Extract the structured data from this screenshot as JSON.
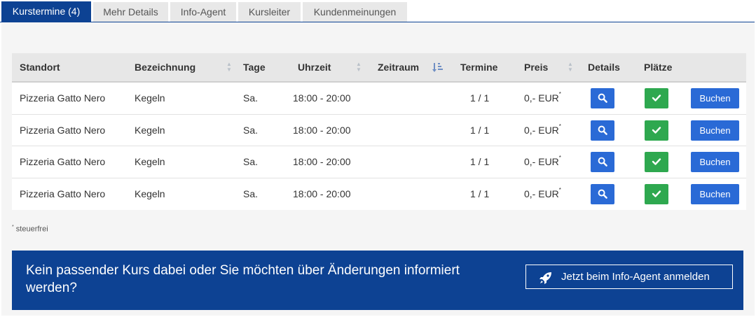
{
  "tabs": [
    {
      "label": "Kurstermine (4)",
      "active": true
    },
    {
      "label": "Mehr Details",
      "active": false
    },
    {
      "label": "Info-Agent",
      "active": false
    },
    {
      "label": "Kursleiter",
      "active": false
    },
    {
      "label": "Kundenmeinungen",
      "active": false
    }
  ],
  "table": {
    "headers": {
      "standort": "Standort",
      "bezeichnung": "Bezeichnung",
      "tage": "Tage",
      "uhrzeit": "Uhrzeit",
      "zeitraum": "Zeitraum",
      "termine": "Termine",
      "preis": "Preis",
      "details": "Details",
      "plaetze": "Plätze"
    },
    "rows": [
      {
        "standort": "Pizzeria Gatto Nero",
        "bezeichnung": "Kegeln",
        "tage": "Sa.",
        "uhrzeit": "18:00 - 20:00",
        "zeitraum": "",
        "termine": "1 / 1",
        "preis": "0,- EUR",
        "preis_mark": "*",
        "book_label": "Buchen"
      },
      {
        "standort": "Pizzeria Gatto Nero",
        "bezeichnung": "Kegeln",
        "tage": "Sa.",
        "uhrzeit": "18:00 - 20:00",
        "zeitraum": "",
        "termine": "1 / 1",
        "preis": "0,- EUR",
        "preis_mark": "*",
        "book_label": "Buchen"
      },
      {
        "standort": "Pizzeria Gatto Nero",
        "bezeichnung": "Kegeln",
        "tage": "Sa.",
        "uhrzeit": "18:00 - 20:00",
        "zeitraum": "",
        "termine": "1 / 1",
        "preis": "0,- EUR",
        "preis_mark": "*",
        "book_label": "Buchen"
      },
      {
        "standort": "Pizzeria Gatto Nero",
        "bezeichnung": "Kegeln",
        "tage": "Sa.",
        "uhrzeit": "18:00 - 20:00",
        "zeitraum": "",
        "termine": "1 / 1",
        "preis": "0,- EUR",
        "preis_mark": "*",
        "book_label": "Buchen"
      }
    ]
  },
  "footnote": {
    "mark": "*",
    "text": " steuerfrei"
  },
  "banner": {
    "text": "Kein passender Kurs dabei oder Sie möchten über Änderungen informiert werden?",
    "button_label": "Jetzt beim Info-Agent anmelden"
  },
  "icons": {
    "details": "search-icon",
    "places": "check-icon",
    "banner_button": "rocket-icon",
    "sort": "sort-icon",
    "sort_active": "sort-amount-icon"
  },
  "colors": {
    "brand": "#0d4293",
    "primary_button": "#2a6ad6",
    "available": "#2ea84f",
    "header_bg": "#e7e7e7",
    "panel_bg": "#f5f5f5"
  }
}
